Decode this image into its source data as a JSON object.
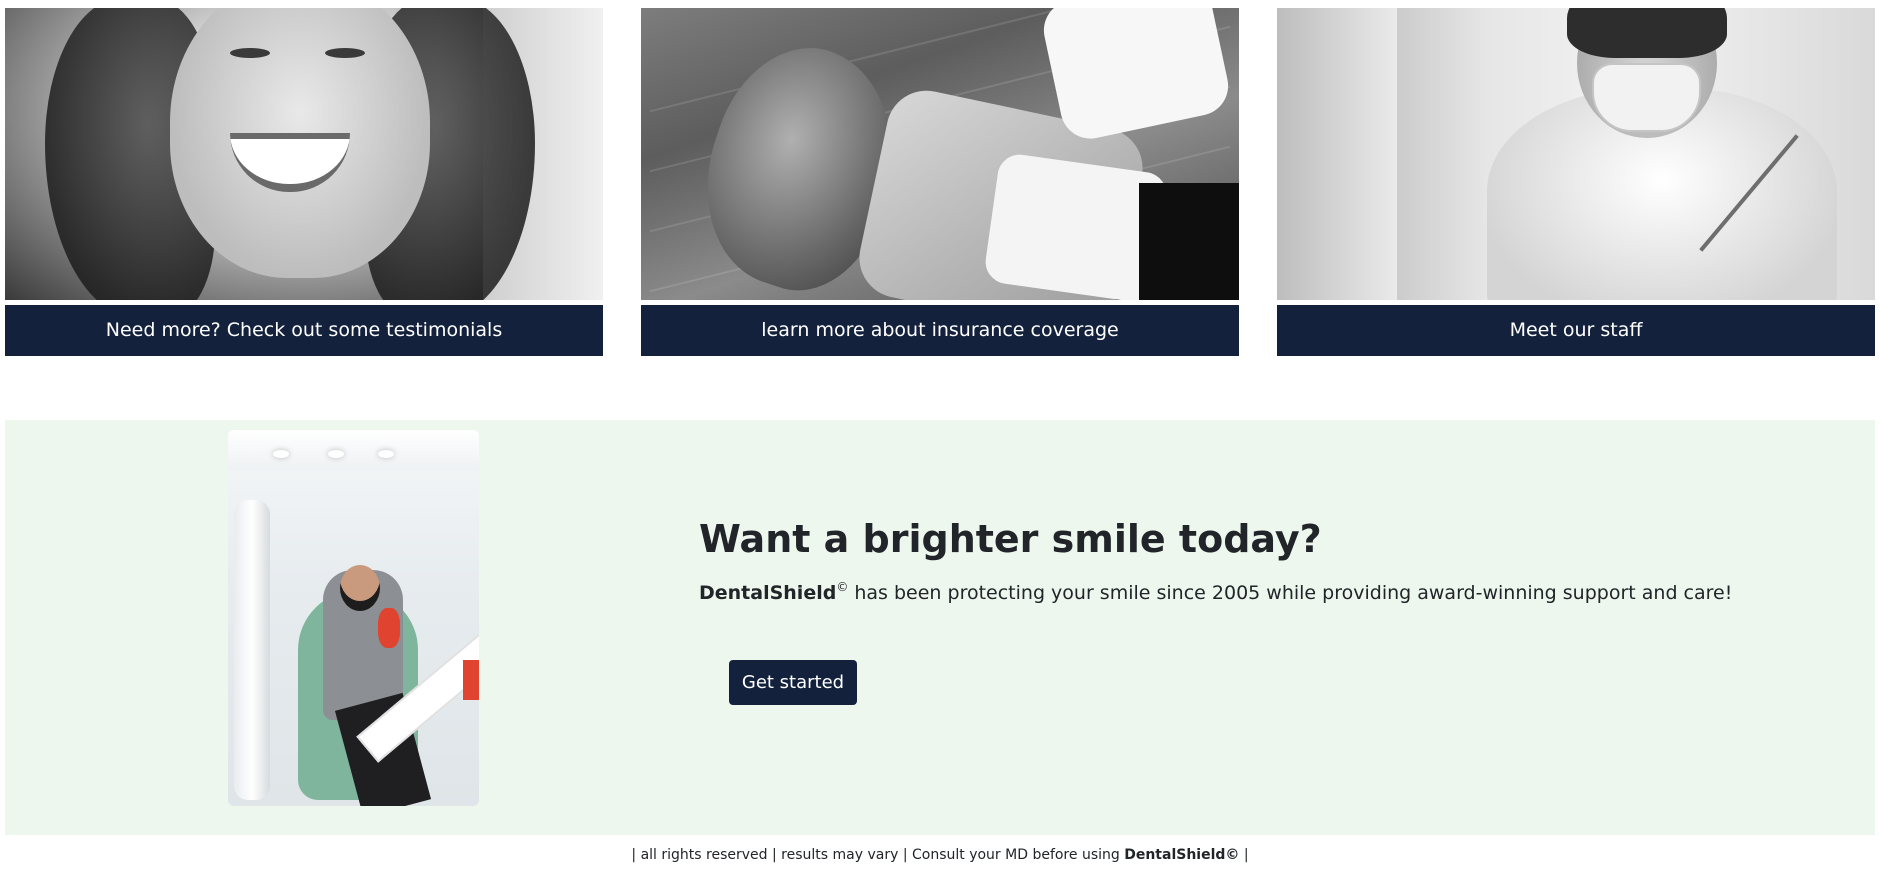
{
  "cards": [
    {
      "link_label": "Need more? Check out some testimonials",
      "image": "smiling-woman-photo"
    },
    {
      "link_label": "learn more about insurance coverage",
      "image": "dental-chair-photo"
    },
    {
      "link_label": "Meet our staff",
      "image": "dentist-at-work-photo"
    }
  ],
  "cta": {
    "image": "patient-in-dental-chair-photo",
    "heading": "Want a brighter smile today?",
    "brand": "DentalShield",
    "copyright_symbol": "©",
    "tagline": " has been protecting your smile since 2005 while providing award-winning support and care!",
    "button_label": "Get started"
  },
  "footer": {
    "text": "| all rights reserved | results may vary | Consult your MD before using ",
    "brand": "DentalShield©",
    "end": " |"
  },
  "colors": {
    "navy": "#13213d",
    "cta_background": "#eef7ee",
    "text": "#212529"
  }
}
